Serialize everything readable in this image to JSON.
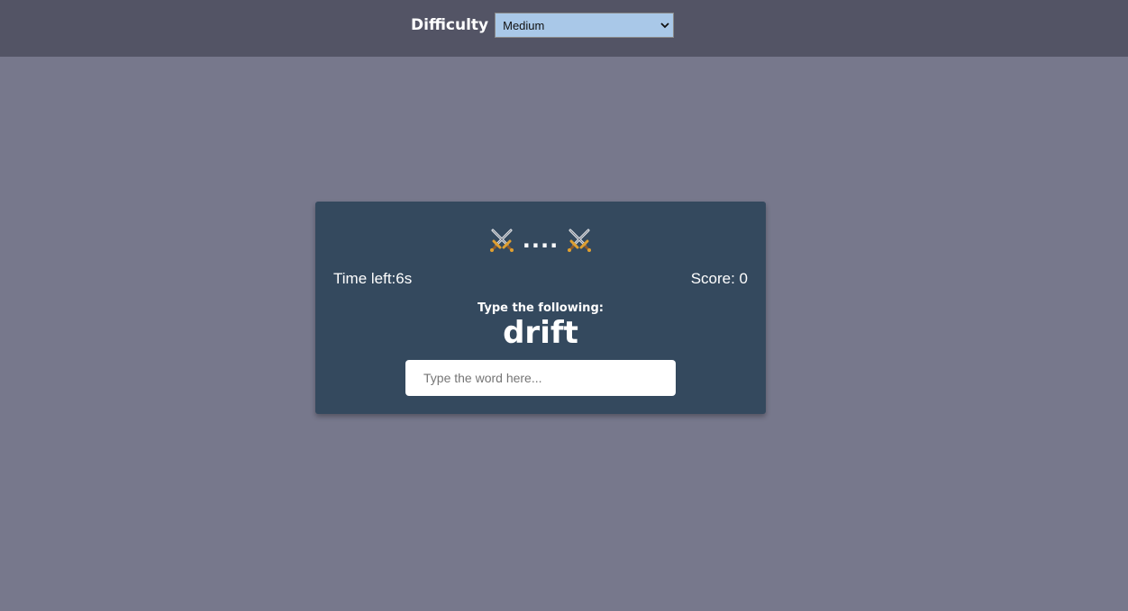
{
  "header": {
    "difficulty_label": "Difficulty",
    "difficulty_selected": "Medium",
    "difficulty_bg": "#a9c8e8"
  },
  "game": {
    "title_dots": "....",
    "left_icon": "crossed-swords-icon",
    "right_icon": "crossed-swords-icon",
    "time_left": "Time left:6s",
    "score": "Score: 0",
    "prompt": "Type the following:",
    "word": "drift",
    "input_placeholder": "Type the word here...",
    "input_value": ""
  },
  "colors": {
    "page_bg": "#77788c",
    "topbar_bg": "#535465",
    "card_bg": "#34495e"
  }
}
